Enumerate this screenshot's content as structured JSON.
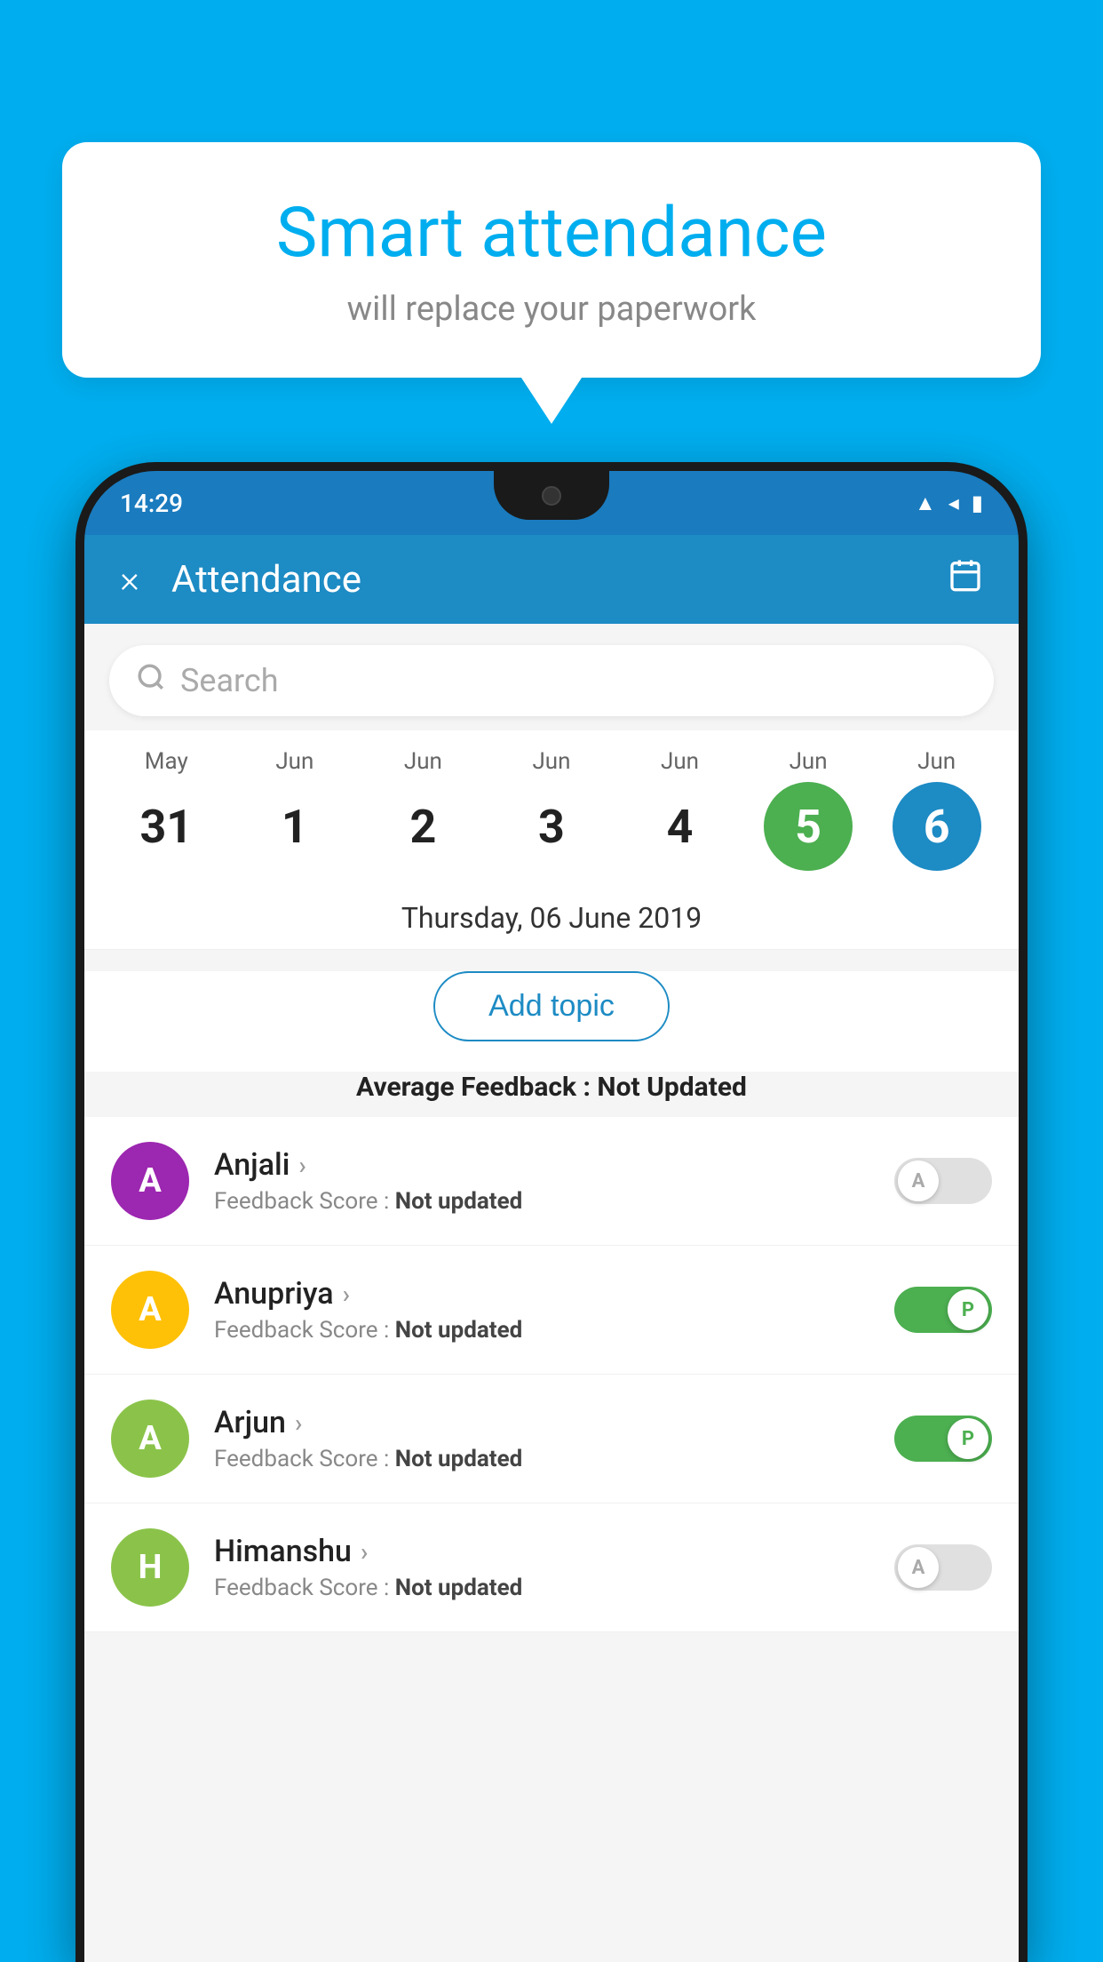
{
  "background_color": "#00AEEF",
  "speech_bubble": {
    "title": "Smart attendance",
    "subtitle": "will replace your paperwork"
  },
  "status_bar": {
    "time": "14:29",
    "icons": [
      "wifi",
      "signal",
      "battery"
    ]
  },
  "header": {
    "title": "Attendance",
    "close_label": "×",
    "calendar_icon": "calendar"
  },
  "search": {
    "placeholder": "Search"
  },
  "calendar": {
    "days": [
      {
        "month": "May",
        "num": "31",
        "state": "normal"
      },
      {
        "month": "Jun",
        "num": "1",
        "state": "normal"
      },
      {
        "month": "Jun",
        "num": "2",
        "state": "normal"
      },
      {
        "month": "Jun",
        "num": "3",
        "state": "normal"
      },
      {
        "month": "Jun",
        "num": "4",
        "state": "normal"
      },
      {
        "month": "Jun",
        "num": "5",
        "state": "today"
      },
      {
        "month": "Jun",
        "num": "6",
        "state": "selected"
      }
    ]
  },
  "selected_date": "Thursday, 06 June 2019",
  "add_topic_label": "Add topic",
  "avg_feedback_label": "Average Feedback :",
  "avg_feedback_value": "Not Updated",
  "students": [
    {
      "name": "Anjali",
      "feedback_label": "Feedback Score :",
      "feedback_value": "Not updated",
      "avatar_letter": "A",
      "avatar_color": "#9C27B0",
      "attendance": "absent"
    },
    {
      "name": "Anupriya",
      "feedback_label": "Feedback Score :",
      "feedback_value": "Not updated",
      "avatar_letter": "A",
      "avatar_color": "#FFC107",
      "attendance": "present"
    },
    {
      "name": "Arjun",
      "feedback_label": "Feedback Score :",
      "feedback_value": "Not updated",
      "avatar_letter": "A",
      "avatar_color": "#8BC34A",
      "attendance": "present"
    },
    {
      "name": "Himanshu",
      "feedback_label": "Feedback Score :",
      "feedback_value": "Not updated",
      "avatar_letter": "H",
      "avatar_color": "#8BC34A",
      "attendance": "absent"
    }
  ],
  "toggle_absent_label": "A",
  "toggle_present_label": "P"
}
